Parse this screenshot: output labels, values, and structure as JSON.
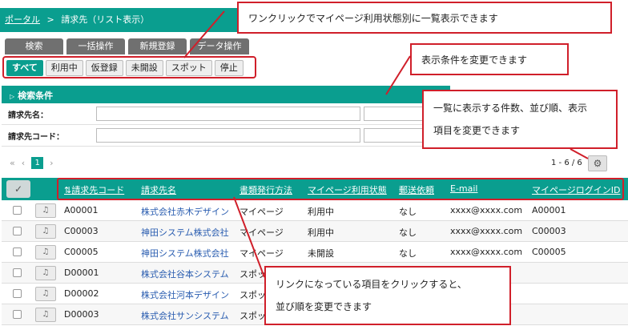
{
  "breadcrumb": {
    "portal": "ポータル",
    "separator": ">",
    "current": "請求先（リスト表示）"
  },
  "tabs": [
    "検索",
    "一括操作",
    "新規登録",
    "データ操作"
  ],
  "filters": [
    "すべて",
    "利用中",
    "仮登録",
    "未開設",
    "スポット",
    "停止"
  ],
  "search": {
    "header": "検索条件",
    "label_name": "請求先名：",
    "label_code": "請求先コード："
  },
  "pagination": {
    "first": "«",
    "prev": "‹",
    "page": "1",
    "next": "›",
    "range": "1 - 6 / 6"
  },
  "table": {
    "headers": [
      "請求先コード",
      "請求先名",
      "書類発行方法",
      "マイページ利用状態",
      "郵送依頼",
      "E-mail",
      "マイページログインID"
    ],
    "sort_icon": "⇅",
    "rows": [
      [
        "A00001",
        "株式会社赤木デザイン",
        "マイページ",
        "利用中",
        "なし",
        "xxxx@xxxx.com",
        "A00001"
      ],
      [
        "C00003",
        "神田システム株式会社",
        "マイページ",
        "利用中",
        "なし",
        "xxxx@xxxx.com",
        "C00003"
      ],
      [
        "C00005",
        "神田システム株式会社",
        "マイページ",
        "未開設",
        "なし",
        "xxxx@xxxx.com",
        "C00005"
      ],
      [
        "D00001",
        "株式会社谷本システム",
        "スポッ",
        "",
        "",
        "",
        ""
      ],
      [
        "D00002",
        "株式会社河本デザイン",
        "スポッ",
        "",
        "",
        "",
        ""
      ],
      [
        "D00003",
        "株式会社サンシステム",
        "スポッ",
        "",
        "",
        "",
        ""
      ]
    ]
  },
  "callouts": {
    "one_click": "ワンクリックでマイページ利用状態別に一覧表示できます",
    "conditions": "表示条件を変更できます",
    "settings_1": "一覧に表示する件数、並び順、表示",
    "settings_2": "項目を変更できます",
    "sort_1": "リンクになっている項目をクリックすると、",
    "sort_2": "並び順を変更できます"
  },
  "colors": {
    "accent": "#0a9e8f",
    "callout_border": "#d01f2a",
    "link": "#2a5db0"
  },
  "icons": {
    "gear": "gear-icon",
    "check": "check-icon",
    "row_action": "doc-icon"
  }
}
